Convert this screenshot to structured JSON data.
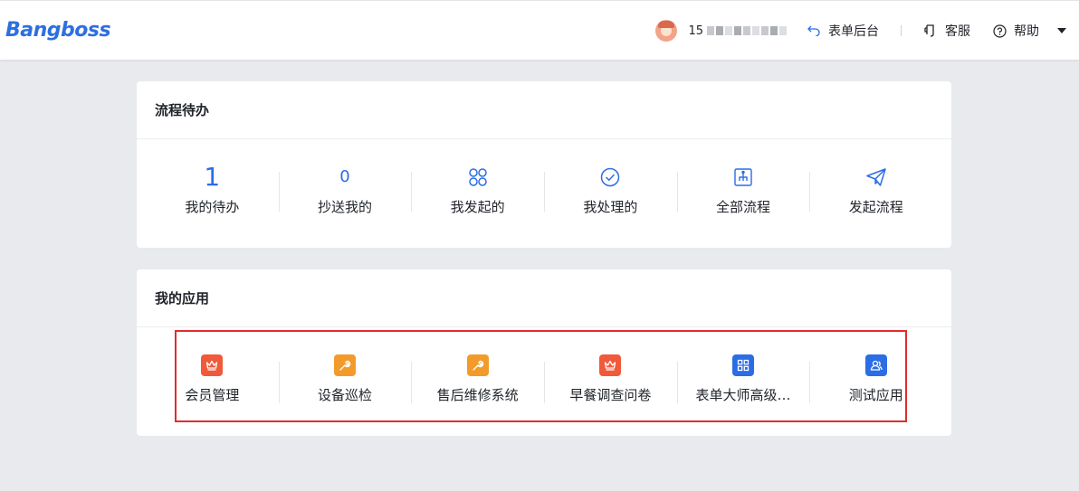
{
  "header": {
    "logo": "Bangboss",
    "username_prefix": "15",
    "form_backend": "表单后台",
    "customer_service": "客服",
    "help": "帮助"
  },
  "flow": {
    "title": "流程待办",
    "items": [
      {
        "value": "1",
        "label": "我的待办"
      },
      {
        "value": "0",
        "label": "抄送我的"
      },
      {
        "icon": "apps-icon",
        "label": "我发起的"
      },
      {
        "icon": "check-circle-icon",
        "label": "我处理的"
      },
      {
        "icon": "org-chart-icon",
        "label": "全部流程"
      },
      {
        "icon": "paper-plane-icon",
        "label": "发起流程"
      }
    ]
  },
  "apps": {
    "title": "我的应用",
    "items": [
      {
        "label": "会员管理",
        "icon": "crown-icon",
        "color": "#f05a3a"
      },
      {
        "label": "设备巡检",
        "icon": "wrench-icon",
        "color": "#f29b2b"
      },
      {
        "label": "售后维修系统",
        "icon": "wrench-icon",
        "color": "#f29b2b"
      },
      {
        "label": "早餐调查问卷",
        "icon": "crown-icon",
        "color": "#f05a3a"
      },
      {
        "label": "表单大师高级…",
        "icon": "grid-icon",
        "color": "#2b6de5"
      },
      {
        "label": "测试应用",
        "icon": "users-icon",
        "color": "#2b6de5"
      }
    ]
  },
  "colors": {
    "accent": "#2b6de5",
    "highlight": "#e02c2c"
  }
}
